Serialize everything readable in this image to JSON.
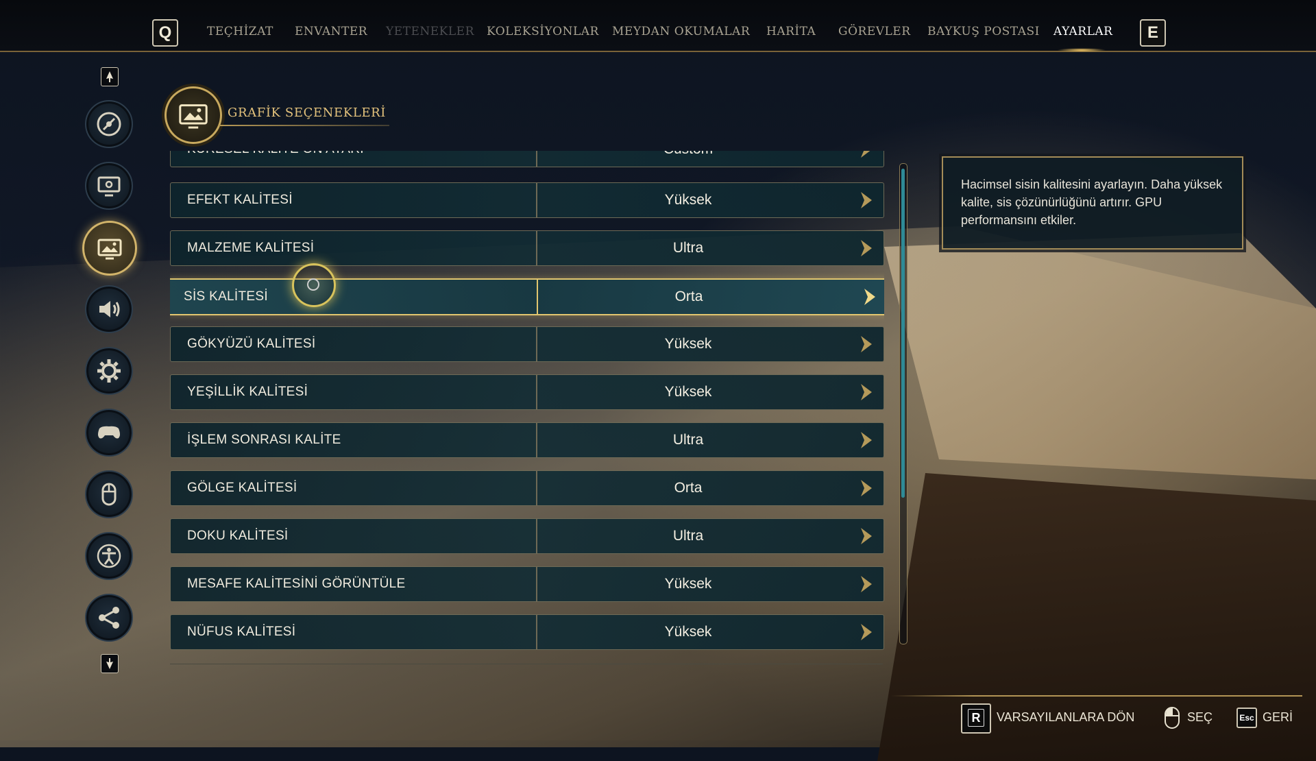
{
  "topbar": {
    "left_key": "Q",
    "right_key": "E",
    "tabs": [
      {
        "label": "TEÇHİZAT",
        "state": "normal"
      },
      {
        "label": "ENVANTER",
        "state": "normal"
      },
      {
        "label": "YETENEKLER",
        "state": "disabled"
      },
      {
        "label": "KOLEKSİYONLAR",
        "state": "normal"
      },
      {
        "label": "MEYDAN OKUMALAR",
        "state": "normal"
      },
      {
        "label": "HARİTA",
        "state": "normal"
      },
      {
        "label": "GÖREVLER",
        "state": "normal"
      },
      {
        "label": "BAYKUŞ POSTASI",
        "state": "normal"
      },
      {
        "label": "AYARLAR",
        "state": "active"
      }
    ]
  },
  "sidebar": {
    "items": [
      {
        "icon": "disc-icon"
      },
      {
        "icon": "monitor-settings-icon"
      },
      {
        "icon": "graphics-image-icon",
        "active": true
      },
      {
        "icon": "speaker-icon"
      },
      {
        "icon": "gear-icon"
      },
      {
        "icon": "gamepad-icon"
      },
      {
        "icon": "mouse-icon"
      },
      {
        "icon": "accessibility-icon"
      },
      {
        "icon": "share-network-icon"
      }
    ]
  },
  "section": {
    "title": "GRAFİK SEÇENEKLERİ"
  },
  "settings": [
    {
      "label": "KÜRESEL KALİTE ÖN AYARI",
      "value": "Custom"
    },
    {
      "label": "EFEKT KALİTESİ",
      "value": "Yüksek"
    },
    {
      "label": "MALZEME KALİTESİ",
      "value": "Ultra"
    },
    {
      "label": "SİS KALİTESİ",
      "value": "Orta",
      "selected": true
    },
    {
      "label": "GÖKYÜZÜ KALİTESİ",
      "value": "Yüksek"
    },
    {
      "label": "YEŞİLLİK KALİTESİ",
      "value": "Yüksek"
    },
    {
      "label": "İŞLEM SONRASI KALİTE",
      "value": "Ultra"
    },
    {
      "label": "GÖLGE KALİTESİ",
      "value": "Orta"
    },
    {
      "label": "DOKU KALİTESİ",
      "value": "Ultra"
    },
    {
      "label": "MESAFE KALİTESİNİ GÖRÜNTÜLE",
      "value": "Yüksek"
    },
    {
      "label": "NÜFUS KALİTESİ",
      "value": "Yüksek"
    }
  ],
  "description": "Hacimsel sisin kalitesini ayarlayın. Daha yüksek kalite, sis çözünürlüğünü artırır. GPU performansını etkiler.",
  "footer": {
    "reset_key": "R",
    "reset_label": "VARSAYILANLARA DÖN",
    "select_label": "SEÇ",
    "back_key": "Esc",
    "back_label": "GERİ"
  },
  "colors": {
    "accent_gold": "#e2c66f",
    "teal": "#2e8a96"
  }
}
